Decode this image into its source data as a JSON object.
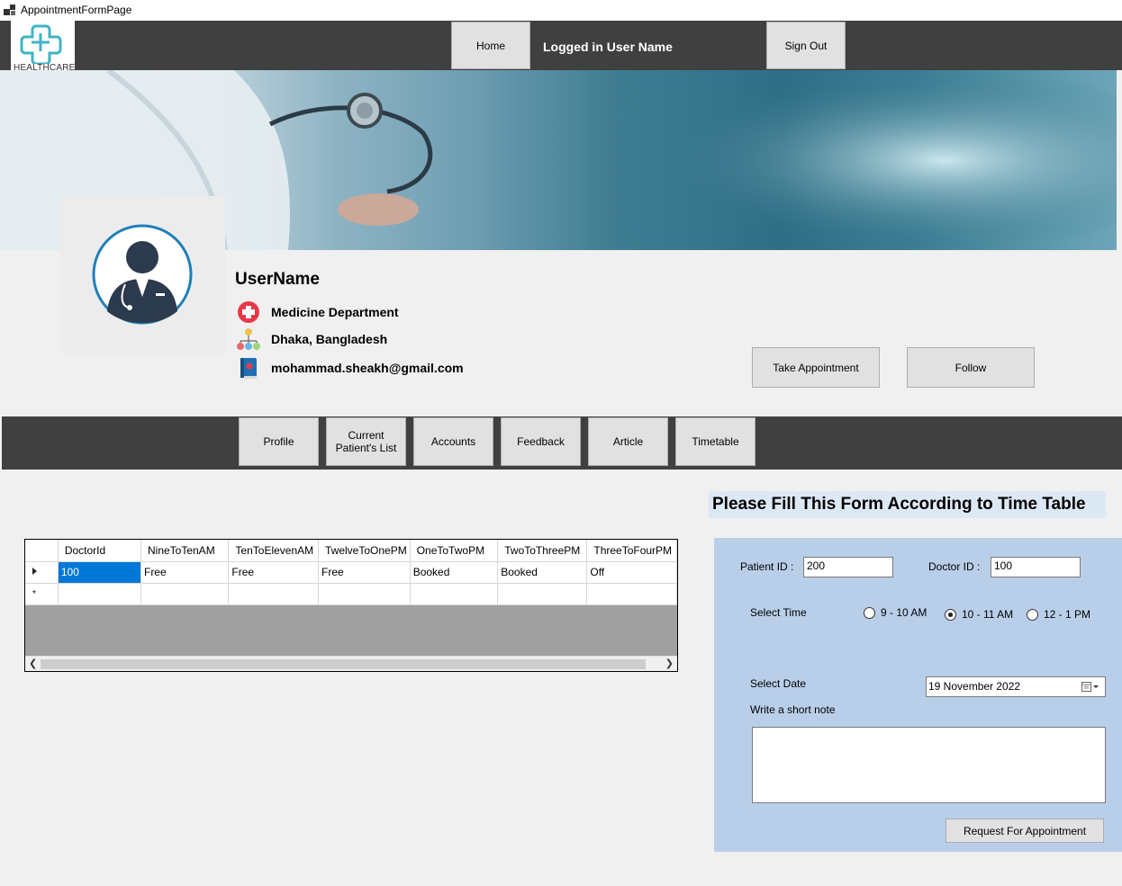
{
  "window": {
    "title": "AppointmentFormPage"
  },
  "header": {
    "logo_text": "HEALTHCARE",
    "home_label": "Home",
    "logged_in_user": "Logged in User Name",
    "signout_label": "Sign Out"
  },
  "profile": {
    "username": "UserName",
    "department": "Medicine Department",
    "location": "Dhaka, Bangladesh",
    "email": "mohammad.sheakh@gmail.com",
    "take_appointment_label": "Take Appointment",
    "follow_label": "Follow"
  },
  "nav": {
    "items": [
      {
        "label": "Profile"
      },
      {
        "label": "Current Patient's List"
      },
      {
        "label": "Accounts"
      },
      {
        "label": "Feedback"
      },
      {
        "label": "Article"
      },
      {
        "label": "Timetable"
      }
    ]
  },
  "timetable": {
    "columns": [
      "DoctorId",
      "NineToTenAM",
      "TenToElevenAM",
      "TwelveToOnePM",
      "OneToTwoPM",
      "TwoToThreePM",
      "ThreeToFourPM"
    ],
    "rows": [
      [
        "100",
        "Free",
        "Free",
        "Free",
        "Booked",
        "Booked",
        "Off"
      ]
    ],
    "new_row_marker": "*"
  },
  "form": {
    "title": "Please Fill This Form According to Time Table",
    "patient_id_label": "Patient ID :",
    "patient_id_value": "200",
    "doctor_id_label": "Doctor ID :",
    "doctor_id_value": "100",
    "select_time_label": "Select Time",
    "time_options": [
      {
        "label": "9 - 10 AM",
        "selected": false
      },
      {
        "label": "10 - 11 AM",
        "selected": true
      },
      {
        "label": "12 - 1 PM",
        "selected": false
      }
    ],
    "select_date_label": "Select Date",
    "date_value": "19 November 2022",
    "note_label": "Write a short note",
    "note_value": "",
    "request_label": "Request For Appointment"
  },
  "colors": {
    "header_bg": "#404040",
    "form_panel_bg": "#b9cfe9",
    "selected_cell": "#0078d7",
    "logo_teal": "#3fb4c4"
  }
}
